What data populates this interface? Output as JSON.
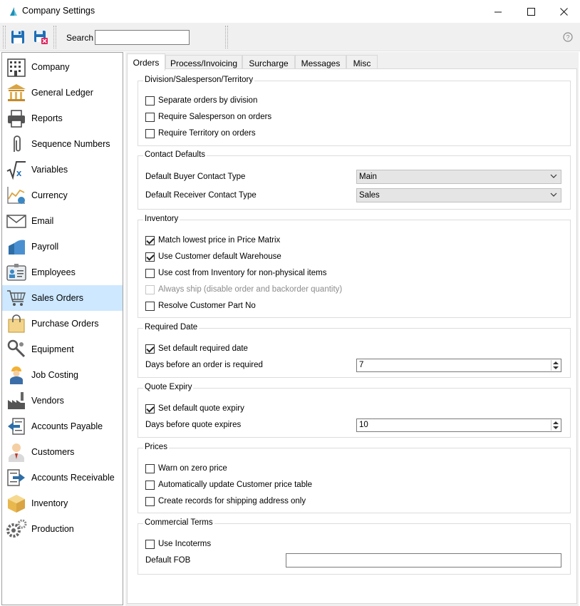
{
  "window": {
    "title": "Company Settings",
    "minimize_glyph": "—",
    "maximize_glyph": "☐",
    "close_glyph": "✕"
  },
  "toolbar": {
    "search_label": "Search",
    "search_value": "",
    "save_icon": "save-icon",
    "save_close_icon": "save-close-icon",
    "help_icon": "help-icon"
  },
  "sidebar": {
    "items": [
      {
        "label": "Company",
        "icon": "building-icon"
      },
      {
        "label": "General Ledger",
        "icon": "bank-icon"
      },
      {
        "label": "Reports",
        "icon": "printer-icon"
      },
      {
        "label": "Sequence Numbers",
        "icon": "paperclip-icon"
      },
      {
        "label": "Variables",
        "icon": "sqrt-x-icon"
      },
      {
        "label": "Currency",
        "icon": "currency-chart-icon"
      },
      {
        "label": "Email",
        "icon": "envelope-icon"
      },
      {
        "label": "Payroll",
        "icon": "payroll-icon"
      },
      {
        "label": "Employees",
        "icon": "id-card-icon"
      },
      {
        "label": "Sales Orders",
        "icon": "shopping-cart-icon"
      },
      {
        "label": "Purchase Orders",
        "icon": "shopping-bag-icon"
      },
      {
        "label": "Equipment",
        "icon": "wrench-icon"
      },
      {
        "label": "Job Costing",
        "icon": "worker-icon"
      },
      {
        "label": "Vendors",
        "icon": "factory-icon"
      },
      {
        "label": "Accounts Payable",
        "icon": "arrow-out-icon"
      },
      {
        "label": "Customers",
        "icon": "person-icon"
      },
      {
        "label": "Accounts Receivable",
        "icon": "arrow-in-icon"
      },
      {
        "label": "Inventory",
        "icon": "box-icon"
      },
      {
        "label": "Production",
        "icon": "gears-icon"
      }
    ],
    "selected": "Sales Orders",
    "selected_color": "#cde8ff"
  },
  "tabs": [
    {
      "label": "Orders",
      "active": true
    },
    {
      "label": "Process/Invoicing",
      "active": false
    },
    {
      "label": "Surcharge",
      "active": false
    },
    {
      "label": "Messages",
      "active": false
    },
    {
      "label": "Misc",
      "active": false
    }
  ],
  "groups": {
    "division": {
      "title": "Division/Salesperson/Territory",
      "checks": [
        {
          "label": "Separate orders by division",
          "checked": false
        },
        {
          "label": "Require Salesperson on orders",
          "checked": false
        },
        {
          "label": "Require Territory on orders",
          "checked": false
        }
      ]
    },
    "contact": {
      "title": "Contact Defaults",
      "buyer_label": "Default Buyer Contact Type",
      "buyer_value": "Main",
      "receiver_label": "Default Receiver Contact Type",
      "receiver_value": "Sales"
    },
    "inventory": {
      "title": "Inventory",
      "checks": [
        {
          "label": "Match lowest price in Price Matrix",
          "checked": true,
          "disabled": false
        },
        {
          "label": "Use Customer default Warehouse",
          "checked": true,
          "disabled": false
        },
        {
          "label": "Use cost from Inventory for non-physical items",
          "checked": false,
          "disabled": false
        },
        {
          "label": "Always ship (disable order and backorder quantity)",
          "checked": false,
          "disabled": true
        },
        {
          "label": "Resolve Customer Part No",
          "checked": false,
          "disabled": false
        }
      ]
    },
    "required_date": {
      "title": "Required Date",
      "check_label": "Set default required date",
      "checked": true,
      "days_label": "Days before an order is required",
      "days_value": "7"
    },
    "quote_expiry": {
      "title": "Quote Expiry",
      "check_label": "Set default quote expiry",
      "checked": true,
      "days_label": "Days before quote expires",
      "days_value": "10"
    },
    "prices": {
      "title": "Prices",
      "checks": [
        {
          "label": "Warn on zero price",
          "checked": false
        },
        {
          "label": "Automatically update Customer price table",
          "checked": false
        },
        {
          "label": "Create records for shipping address only",
          "checked": false
        }
      ]
    },
    "commercial": {
      "title": "Commercial Terms",
      "check_label": "Use Incoterms",
      "checked": false,
      "fob_label": "Default FOB",
      "fob_value": ""
    }
  }
}
